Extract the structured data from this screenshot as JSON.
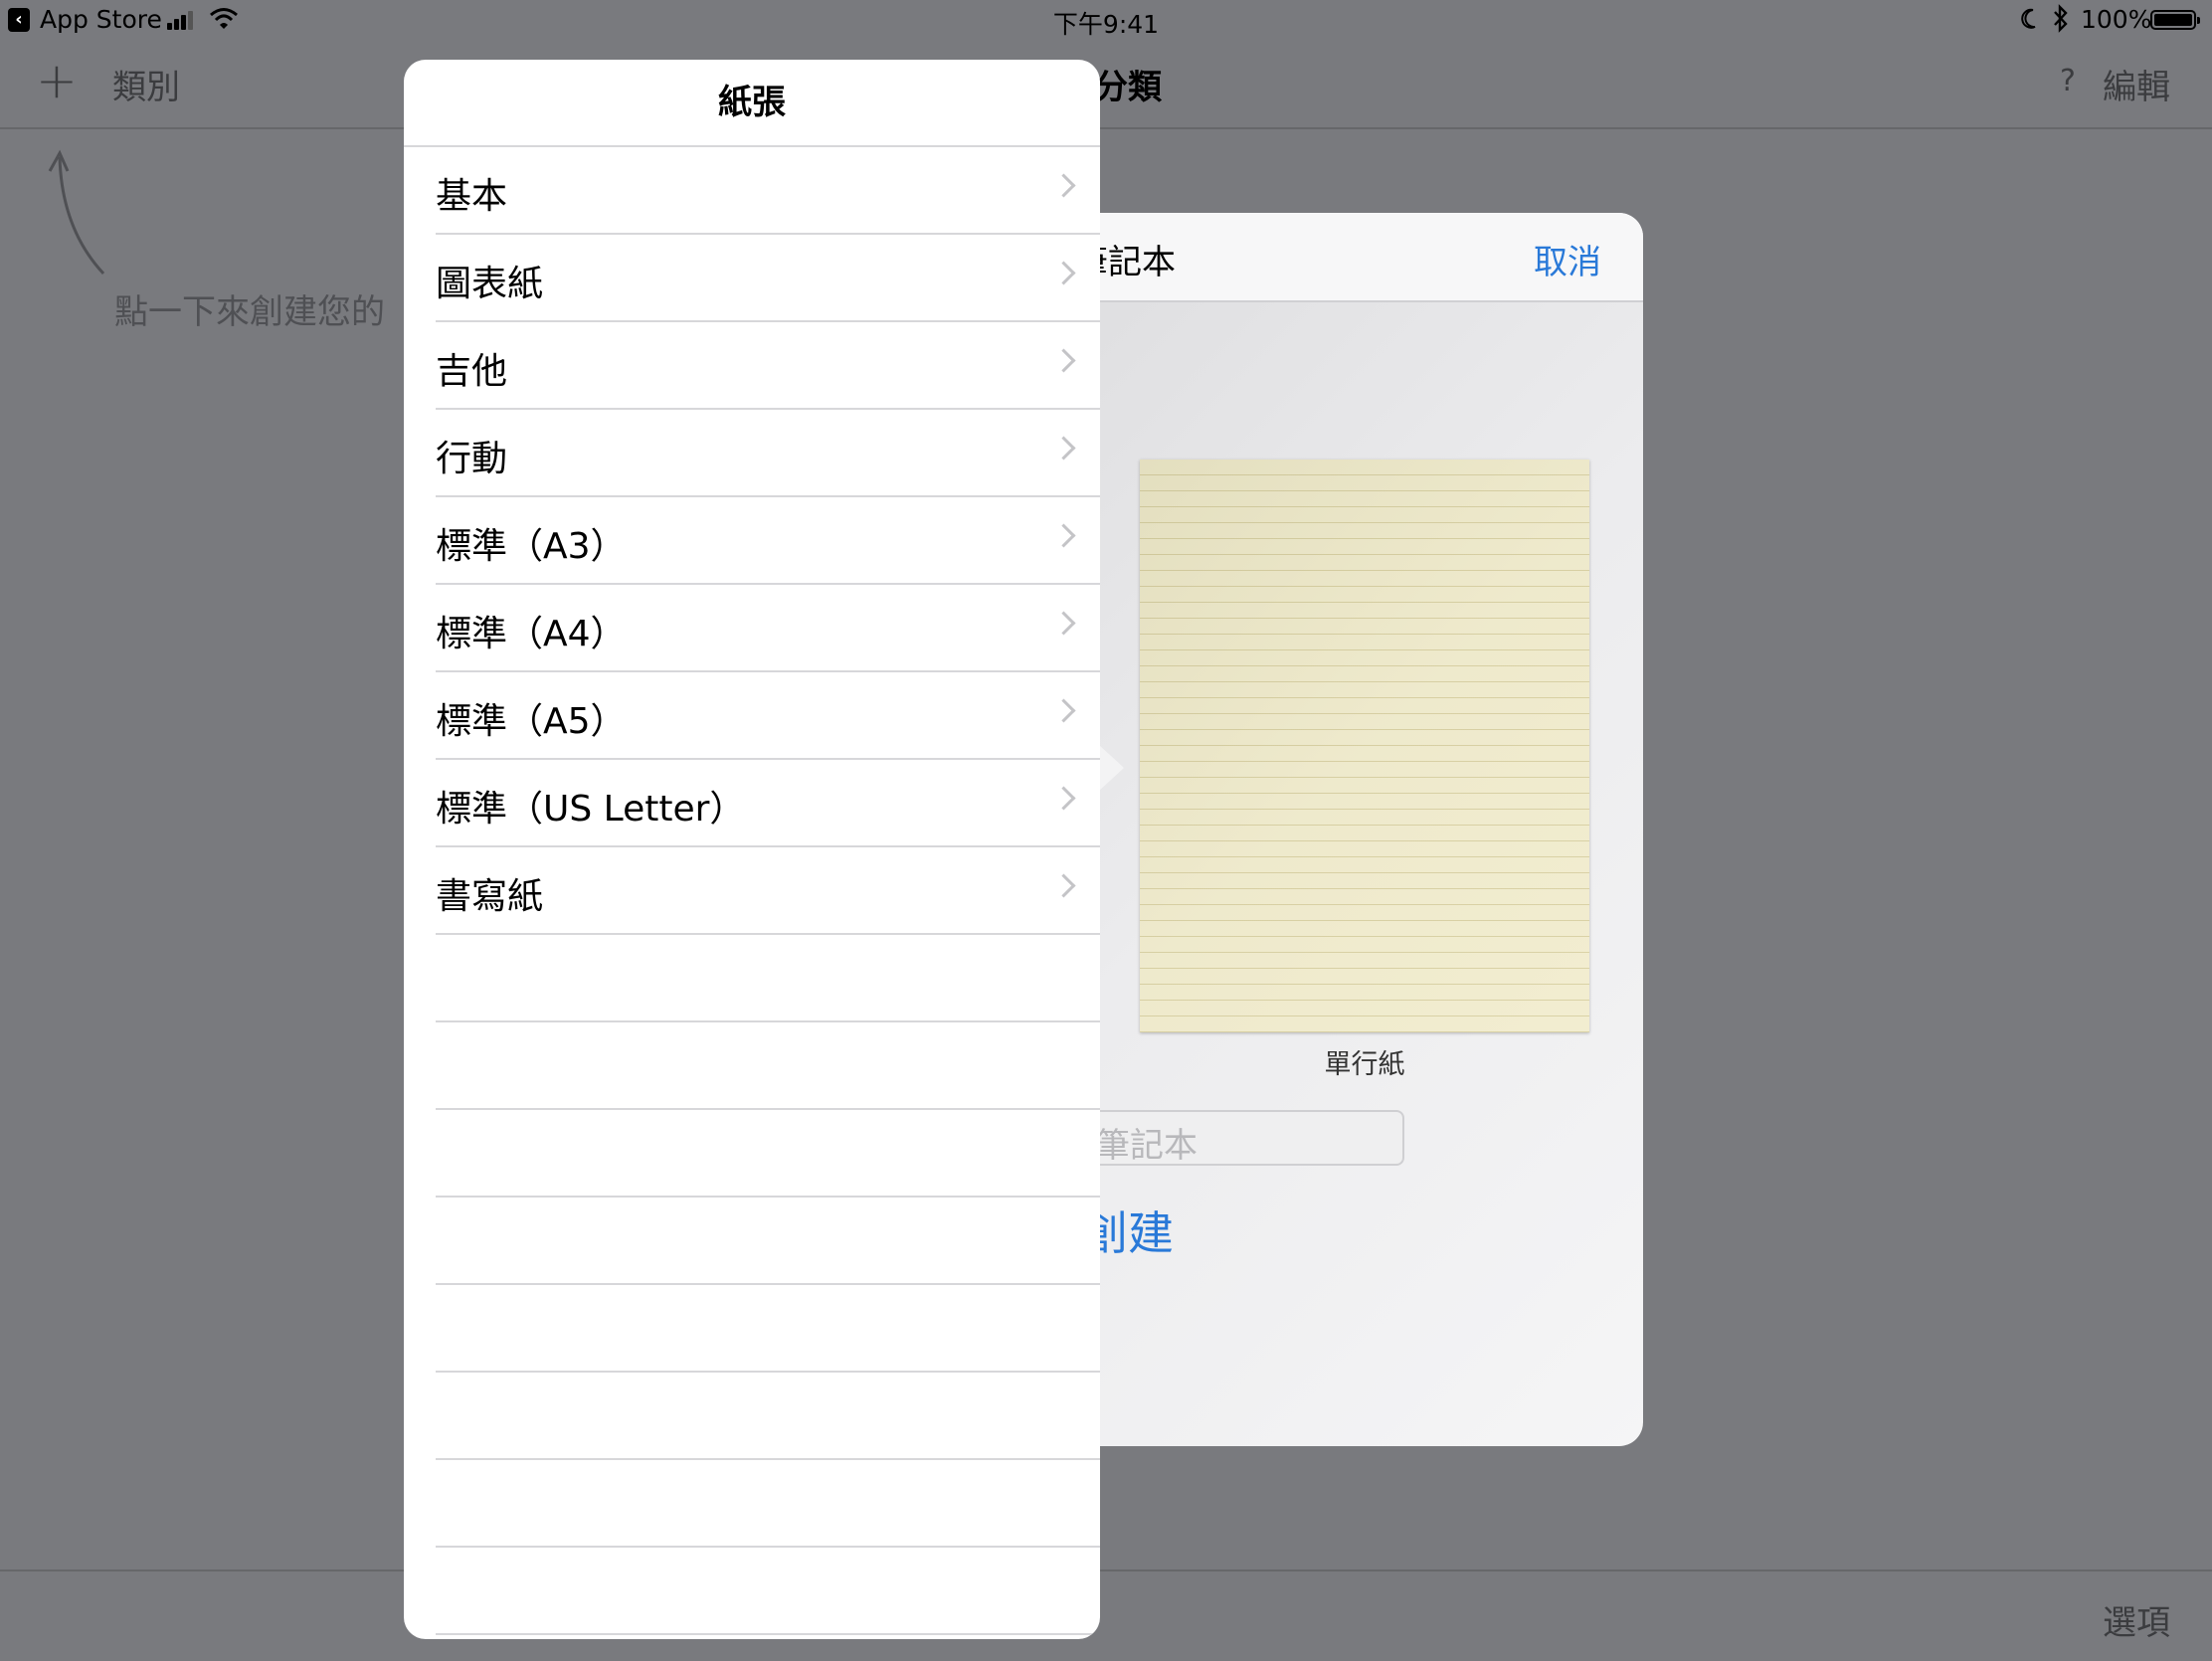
{
  "status_bar": {
    "back_app": "App Store",
    "time": "下午9:41",
    "battery": "100%"
  },
  "nav": {
    "category_label": "類別",
    "title": "分類",
    "help": "?",
    "edit_label": "編輯"
  },
  "hint_text": "點一下來創建您的",
  "bottom_bar": {
    "options_label": "選項"
  },
  "sheet": {
    "title": "筆記本",
    "cancel_label": "取消",
    "paper_caption": "單行紙",
    "name_placeholder": "筆記本",
    "create_label": "創建"
  },
  "popover": {
    "title": "紙張",
    "items": [
      {
        "label": "基本"
      },
      {
        "label": "圖表紙"
      },
      {
        "label": "吉他"
      },
      {
        "label": "行動"
      },
      {
        "label": "標準（A3）"
      },
      {
        "label": "標準（A4）"
      },
      {
        "label": "標準（A5）"
      },
      {
        "label": "標準（US Letter）"
      },
      {
        "label": "書寫紙"
      }
    ]
  }
}
